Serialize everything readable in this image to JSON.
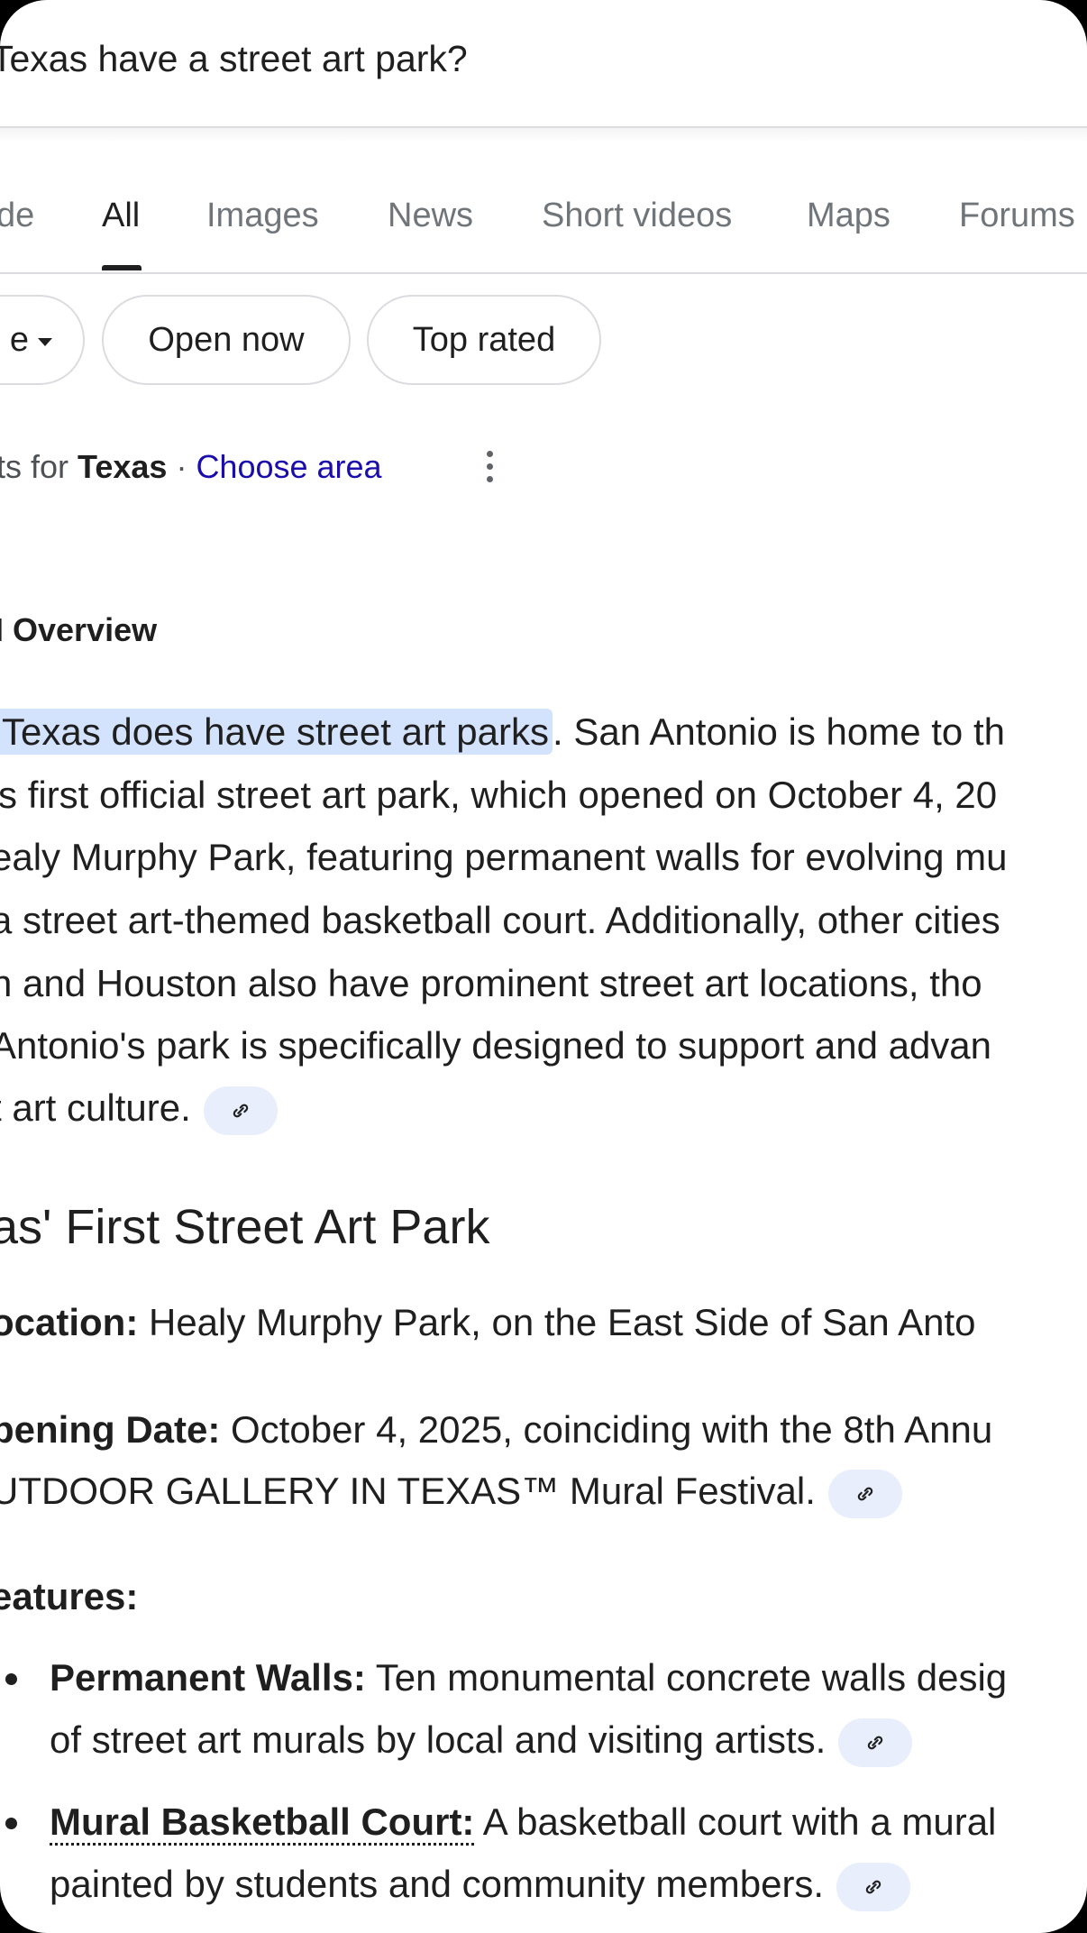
{
  "search": {
    "query": "Texas have a street art park?"
  },
  "tabs": [
    {
      "label": "de"
    },
    {
      "label": "All"
    },
    {
      "label": "Images"
    },
    {
      "label": "News"
    },
    {
      "label": "Short videos"
    },
    {
      "label": "Maps"
    },
    {
      "label": "Forums"
    }
  ],
  "chips": [
    {
      "label": "e"
    },
    {
      "label": "Open now"
    },
    {
      "label": "Top rated"
    }
  ],
  "results_for": {
    "prefix": "ts for ",
    "location": "Texas",
    "separator": " · ",
    "choose_area": "Choose area"
  },
  "ai_overview": {
    "title": "I Overview",
    "highlight": "Texas does have street art parks",
    "lines": [
      ". San Antonio is home to th",
      "'s first official street art park, which opened on October 4, 20",
      "ealy Murphy Park, featuring permanent walls for evolving mu",
      "a street art-themed basketball court. Additionally, other cities",
      "n and Houston also have prominent street art locations, tho",
      "Antonio's park is specifically designed to support and advan",
      "t art culture."
    ]
  },
  "section": {
    "heading": "as' First Street Art Park",
    "location_label": "ocation:",
    "location_text": " Healy Murphy Park, on the East Side of San Anto",
    "opening_label": "pening Date:",
    "opening_text": " October 4, 2025, coinciding with the 8th Annu",
    "opening_text_2": "UTDOOR GALLERY IN TEXAS™ Mural Festival.",
    "features_label": "eatures:",
    "bullets": [
      {
        "label": "Permanent Walls:",
        "text": " Ten monumental concrete walls desig",
        "text_2": "of street art murals by local and visiting artists."
      },
      {
        "label": "Mural Basketball Court:",
        "text": " A basketball court with a mural",
        "text_2": "painted by students and community members."
      }
    ]
  }
}
